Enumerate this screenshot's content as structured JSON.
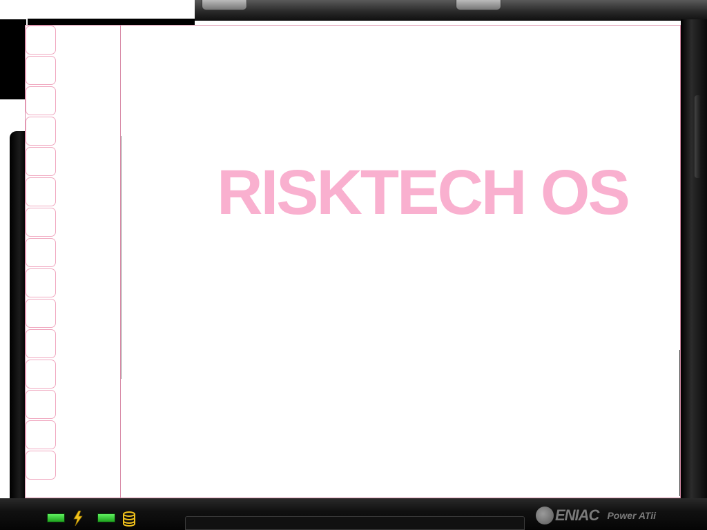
{
  "screen": {
    "title": "RISKTECH OS",
    "title_color": "#f9b0cf",
    "border_color": "#d88aa6"
  },
  "sidebar": {
    "slot_count": 15
  },
  "status_bar": {
    "indicators": [
      {
        "name": "power-led",
        "icon": "lightning-bolt-icon",
        "color": "#3fd93f"
      },
      {
        "name": "disk-led",
        "icon": "database-icon",
        "color": "#3fd93f"
      }
    ],
    "brand_logo": "ENIAC",
    "brand_model": "Power ATii"
  }
}
